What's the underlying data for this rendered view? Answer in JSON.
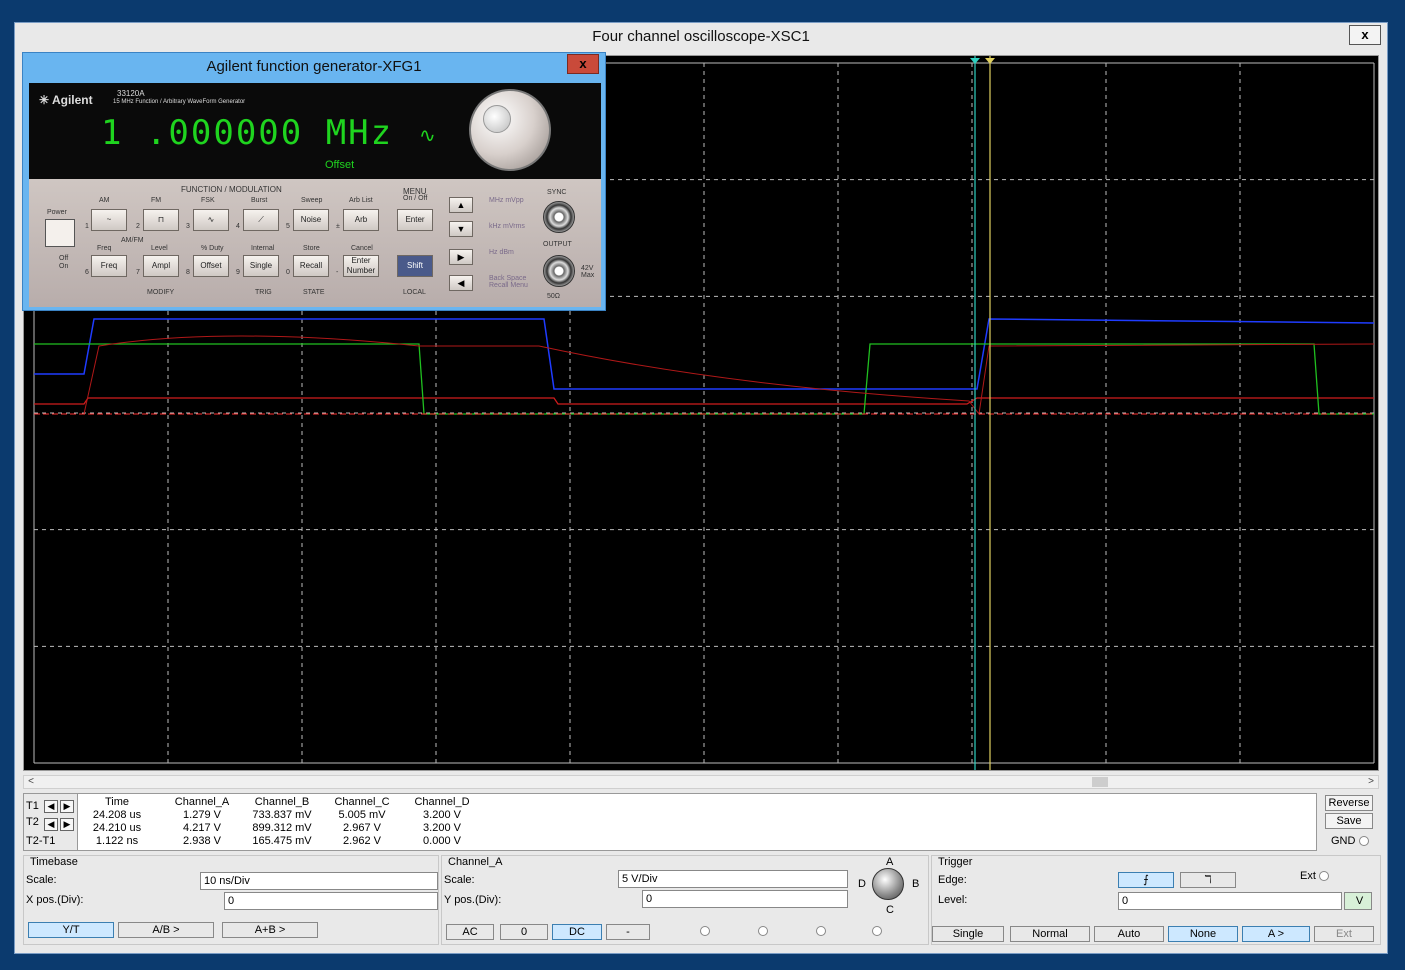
{
  "scope": {
    "title": "Four channel oscilloscope-XSC1",
    "close": "x",
    "readout": {
      "row_labels": [
        "T1",
        "T2",
        "T2-T1"
      ],
      "headers": [
        "Time",
        "Channel_A",
        "Channel_B",
        "Channel_C",
        "Channel_D"
      ],
      "rows": [
        [
          "24.208 us",
          "1.279 V",
          "733.837 mV",
          "5.005 mV",
          "3.200 V"
        ],
        [
          "24.210 us",
          "4.217 V",
          "899.312 mV",
          "2.967 V",
          "3.200 V"
        ],
        [
          "1.122 ns",
          "2.938 V",
          "165.475 mV",
          "2.962 V",
          "0.000 V"
        ]
      ]
    },
    "reverse": "Reverse",
    "save": "Save",
    "gnd": "GND",
    "timebase": {
      "title": "Timebase",
      "scale_label": "Scale:",
      "scale_value": "10 ns/Div",
      "xpos_label": "X pos.(Div):",
      "xpos_value": "0",
      "modes": [
        "Y/T",
        "A/B >",
        "A+B >"
      ]
    },
    "channel": {
      "title": "Channel_A",
      "scale_label": "Scale:",
      "scale_value": "5  V/Div",
      "ypos_label": "Y pos.(Div):",
      "ypos_value": "0",
      "coupling": [
        "AC",
        "0",
        "DC",
        "-"
      ],
      "knob_labels": {
        "a": "A",
        "b": "B",
        "c": "C",
        "d": "D"
      }
    },
    "trigger": {
      "title": "Trigger",
      "edge_label": "Edge:",
      "level_label": "Level:",
      "level_value": "0",
      "level_unit": "V",
      "ext": "Ext",
      "edge_rise": "⨍",
      "edge_fall": "ℸ",
      "modes": [
        "Single",
        "Normal",
        "Auto",
        "None",
        "A >",
        "Ext"
      ]
    }
  },
  "generator": {
    "title": "Agilent function generator-XFG1",
    "close": "x",
    "brand": "Agilent",
    "model": "33120A",
    "model_desc": "15 MHz Function / Arbitrary WaveForm Generator",
    "frequency": "1 .000000 MHz",
    "offset_label": "Offset",
    "function_header": "FUNCTION / MODULATION",
    "menu_header": "MENU",
    "menu_sub": "On / Off",
    "power": "Power",
    "off": "Off",
    "on": "On",
    "top_labels": [
      "AM",
      "FM",
      "FSK",
      "Burst",
      "Sweep",
      "Arb List"
    ],
    "top_buttons": [
      "~",
      "⊓",
      "∿",
      "⟋",
      "Noise",
      "Arb"
    ],
    "top_nums": [
      "1",
      "2",
      "3",
      "4",
      "5",
      "±"
    ],
    "mid_labels": [
      "AM/FM",
      "Freq",
      "Level",
      "% Duty",
      "Internal",
      "Store",
      "Cancel"
    ],
    "bottom_buttons": [
      "Freq",
      "Ampl",
      "Offset",
      "Single",
      "Recall",
      "Enter Number",
      "Shift"
    ],
    "bottom_nums": [
      "6",
      "7",
      "8",
      "9",
      "0",
      "-"
    ],
    "enter": "Enter",
    "group_labels": [
      "MODIFY",
      "TRIG",
      "STATE",
      "LOCAL"
    ],
    "unit_labels": [
      "MHz mVpp",
      "kHz mVrms",
      "Hz dBm",
      "Back Space Recall Menu"
    ],
    "sync": "SYNC",
    "output": "OUTPUT",
    "max": "42V Max",
    "ohm": "50Ω"
  }
}
